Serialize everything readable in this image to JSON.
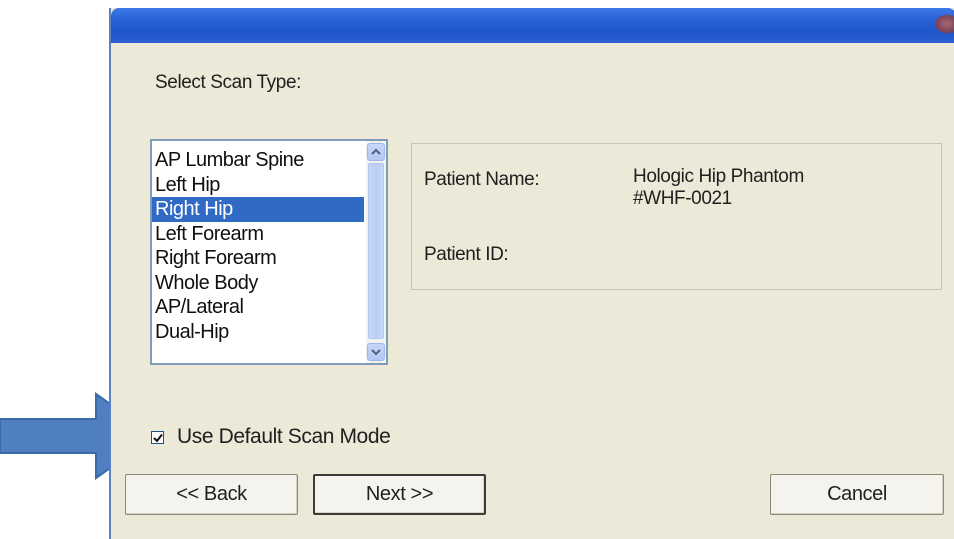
{
  "dialog": {
    "select_label": "Select Scan Type:",
    "scan_types": [
      "AP Lumbar Spine",
      "Left Hip",
      "Right Hip",
      "Left Forearm",
      "Right Forearm",
      "Whole Body",
      "AP/Lateral",
      "Dual-Hip"
    ],
    "selected_scan_type": "Right Hip",
    "patient": {
      "name_label": "Patient Name:",
      "name_value_line1": "Hologic Hip Phantom",
      "name_value_line2": "#WHF-0021",
      "id_label": "Patient ID:",
      "id_value": ""
    },
    "default_scan_mode": {
      "label": "Use Default Scan Mode",
      "checked": true
    },
    "buttons": {
      "back": "<< Back",
      "next": "Next >>",
      "cancel": "Cancel"
    }
  },
  "colors": {
    "titlebar": "#2a63d8",
    "dialog_bg": "#ece9d8",
    "selection": "#316ac5",
    "arrow": "#4f7fc0"
  },
  "icons": {
    "arrow": "right-arrow-icon",
    "checkbox": "checkmark-icon",
    "scroll_up": "chevron-up-icon",
    "scroll_down": "chevron-down-icon"
  }
}
